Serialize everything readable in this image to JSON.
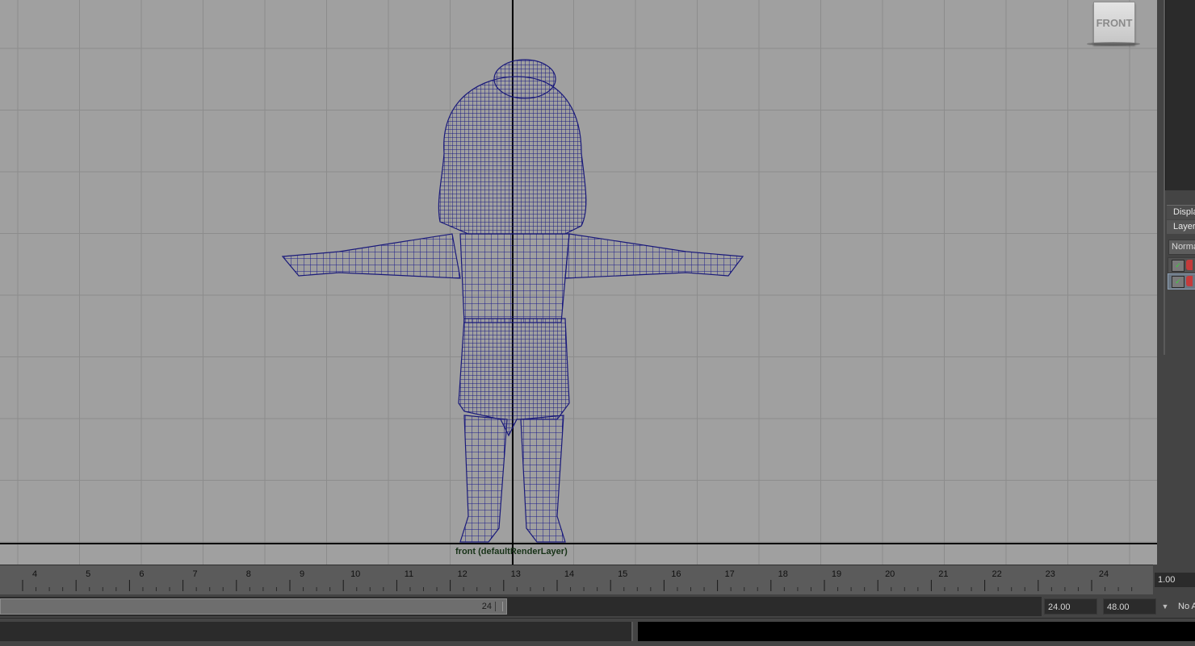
{
  "viewport": {
    "viewcube_label": "FRONT",
    "camera_label": "front (defaultRenderLayer)",
    "grid_color": "#8c8c8c",
    "background_color": "#a0a0a0",
    "axis_color": "#000000",
    "wireframe_color": "#1a1a7a"
  },
  "layer_panel": {
    "tab_display": "Display",
    "tab_layers": "Layers",
    "blend_mode": "Normal"
  },
  "time_slider": {
    "tick_labels": [
      "4",
      "5",
      "6",
      "7",
      "8",
      "9",
      "10",
      "11",
      "12",
      "13",
      "14",
      "15",
      "16",
      "17",
      "18",
      "19",
      "20",
      "21",
      "22",
      "23",
      "24"
    ],
    "current_frame": "1.00"
  },
  "range_slider": {
    "handle_label": "24",
    "anim_end": "24.00",
    "anim_max": "48.00",
    "anim_layer": "No Anim Layer"
  }
}
